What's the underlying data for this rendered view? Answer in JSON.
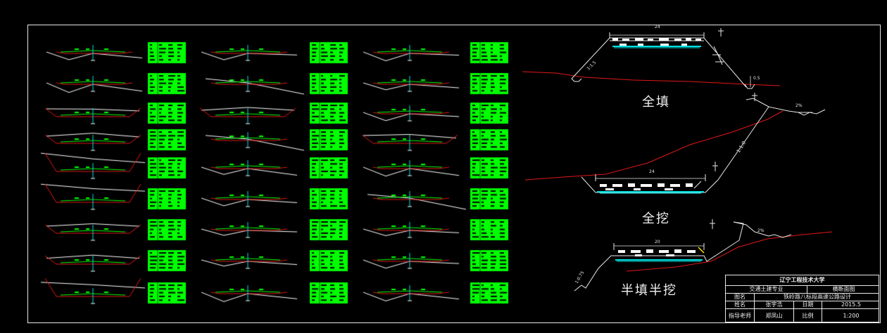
{
  "drawing": {
    "diagram_labels": {
      "full_fill": "全填",
      "full_cut": "全挖",
      "half_fill_half_cut": "半填半挖"
    },
    "dimension_labels": {
      "top_width": "24",
      "bottom_width": "24",
      "half_width": "20",
      "fill_slope": "1:1.5",
      "cut_slope": "1:1.0",
      "ditch": "0.5",
      "platform": "2%",
      "half_slope": "1:0.75"
    }
  },
  "title_block": {
    "school": "辽宁工程技术大学",
    "major": "交通土建专业",
    "drawing_name": "横断面图",
    "name_label": "图名",
    "project": "铁岭路八标段高速公路设计",
    "name_label2": "姓名",
    "author": "张宇浩",
    "date_label": "日期",
    "date": "2015.5",
    "advisor_label": "指导老师",
    "advisor": "郑凤山",
    "scale_label": "比例",
    "scale": "1:200"
  },
  "colors": {
    "background": "#000000",
    "frame": "#e8e8e8",
    "ground_line": "#ffffff",
    "design_line": "#00ff00",
    "red_line": "#e01818",
    "cyan_line": "#00e0e0",
    "table": "#00ff00"
  }
}
